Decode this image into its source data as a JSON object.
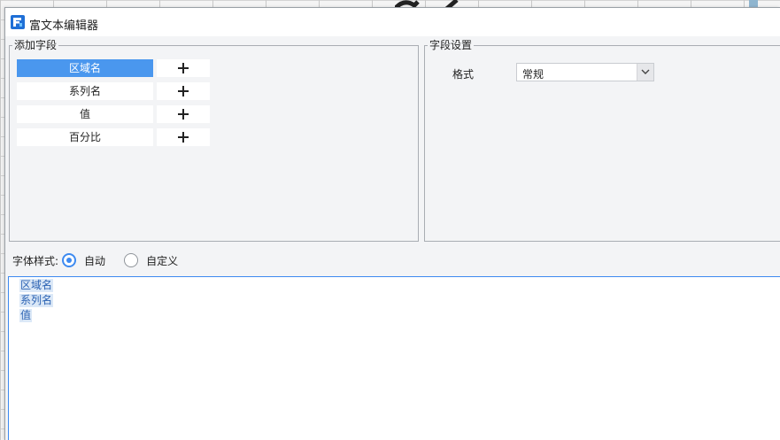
{
  "window": {
    "title": "富文本编辑器"
  },
  "add_fields": {
    "legend": "添加字段",
    "items": [
      {
        "label": "区域名",
        "selected": true
      },
      {
        "label": "系列名",
        "selected": false
      },
      {
        "label": "值",
        "selected": false
      },
      {
        "label": "百分比",
        "selected": false
      }
    ]
  },
  "field_settings": {
    "legend": "字段设置",
    "format_label": "格式",
    "format_value": "常规"
  },
  "font_style": {
    "label": "字体样式:",
    "options": [
      {
        "label": "自动",
        "checked": true
      },
      {
        "label": "自定义",
        "checked": false
      }
    ]
  },
  "editor": {
    "lines": [
      "区域名",
      "系列名",
      "值"
    ]
  },
  "colors": {
    "accent": "#4a97ee",
    "radio_accent": "#3d8af0",
    "tag_text": "#2b62b3",
    "tag_bg": "#dbe8f7"
  },
  "icons": {
    "logo": "app-logo-icon",
    "add": "plus-icon",
    "dropdown": "chevron-down-icon"
  }
}
